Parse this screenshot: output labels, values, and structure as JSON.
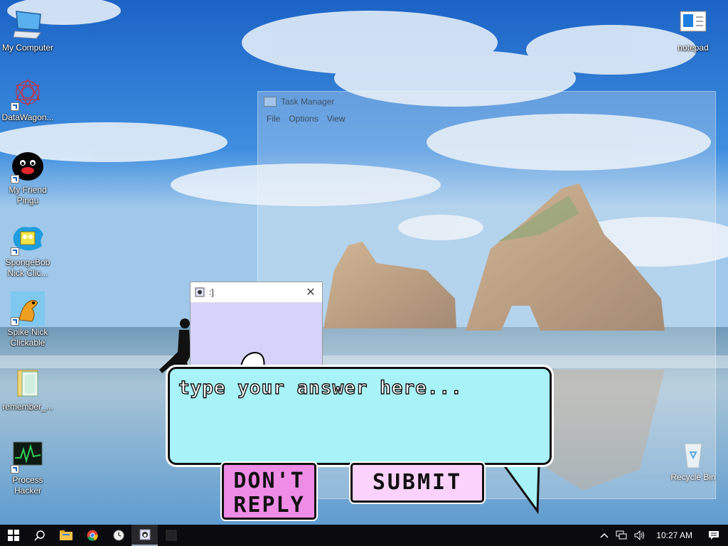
{
  "desktop": {
    "icons": [
      {
        "label": "My Computer",
        "icon": "computer-icon"
      },
      {
        "label": "DataWagon...",
        "icon": "spirograph-icon"
      },
      {
        "label": "My Friend Pingu",
        "icon": "penguin-icon"
      },
      {
        "label": "SpongeBob Nick Clic...",
        "icon": "spongebob-icon"
      },
      {
        "label": "Spike Nick Clickable",
        "icon": "spike-icon"
      },
      {
        "label": "remember_...",
        "icon": "folder-icon"
      },
      {
        "label": "Process Hacker",
        "icon": "monitor-graph-icon"
      },
      {
        "label": "notepad",
        "icon": "notepad-icon"
      },
      {
        "label": "Recycle Bin",
        "icon": "recycle-bin-icon"
      }
    ]
  },
  "task_manager": {
    "title": "Task Manager",
    "menu": [
      "File",
      "Options",
      "View"
    ]
  },
  "popup": {
    "title": ":]"
  },
  "dialog": {
    "placeholder": "type your answer here...",
    "dont_reply_line1": "DON'T",
    "dont_reply_line2": "REPLY",
    "submit_label": "SUBMIT"
  },
  "taskbar": {
    "clock": "10:27 AM",
    "pinned": [
      "start-icon",
      "search-icon",
      "file-explorer-icon",
      "chrome-icon",
      "clock-app-icon",
      "penguin-app-icon",
      "blank-app-icon"
    ]
  },
  "colors": {
    "bubble": "#a8f3f8",
    "dont_reply_button": "#ee8ce6",
    "submit_button": "#fbd2fb",
    "popup_body": "#d6d3fb",
    "taskbar": "#0b0b0f"
  }
}
